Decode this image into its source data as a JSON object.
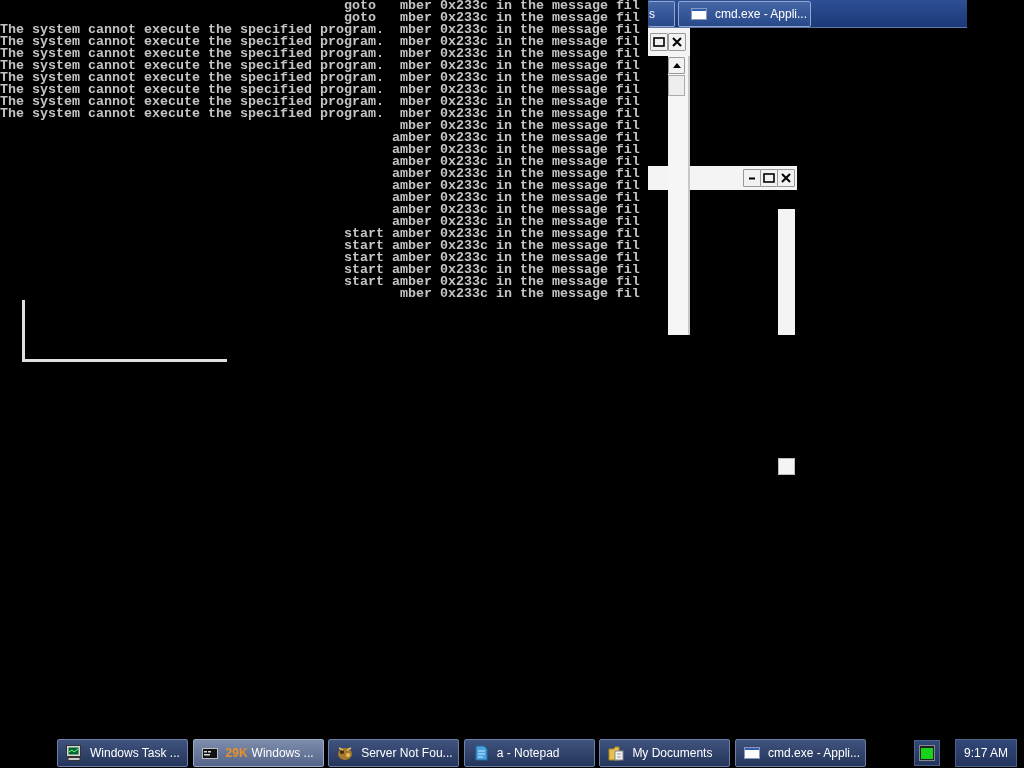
{
  "console": {
    "lines": [
      "                                           goto   mber 0x233c in the message fil",
      "                                           goto   mber 0x233c in the message fil",
      "The system cannot execute the specified program.  mber 0x233c in the message fil",
      "The system cannot execute the specified program.  mber 0x233c in the message fil",
      "The system cannot execute the specified program.  mber 0x233c in the message fil",
      "The system cannot execute the specified program.  mber 0x233c in the message fil",
      "The system cannot execute the specified program.  mber 0x233c in the message fil",
      "The system cannot execute the specified program.  mber 0x233c in the message fil",
      "The system cannot execute the specified program.  mber 0x233c in the message fil",
      "The system cannot execute the specified program.  mber 0x233c in the message fil",
      "                                                  mber 0x233c in the message fil",
      "                                                 amber 0x233c in the message fil",
      "                                                 amber 0x233c in the message fil",
      "                                                 amber 0x233c in the message fil",
      "                                                 amber 0x233c in the message fil",
      "                                                 amber 0x233c in the message fil",
      "                                                 amber 0x233c in the message fil",
      "                                                 amber 0x233c in the message fil",
      "                                                 amber 0x233c in the message fil",
      "                                           start amber 0x233c in the message fil",
      "                                           start amber 0x233c in the message fil",
      "                                           start amber 0x233c in the message fil",
      "                                           start amber 0x233c in the message fil",
      "                                           start amber 0x233c in the message fil",
      "                                                  mber 0x233c in the message fil"
    ]
  },
  "top_taskbar_fragment": {
    "buttons": [
      {
        "label": "s"
      },
      {
        "label": "cmd.exe - Appli..."
      }
    ]
  },
  "taskbar": {
    "buttons": [
      {
        "label": "Windows Task ...",
        "grouped": false,
        "selected": false
      },
      {
        "count": "29K",
        "label": "Windows ...",
        "grouped": true,
        "selected": true
      },
      {
        "label": "Server Not Fou...",
        "grouped": false,
        "selected": false
      },
      {
        "label": "a - Notepad",
        "grouped": false,
        "selected": false
      },
      {
        "label": "My Documents",
        "grouped": false,
        "selected": false
      },
      {
        "label": "cmd.exe - Appli...",
        "grouped": false,
        "selected": false
      }
    ],
    "tray": {
      "clock": "9:17 AM"
    }
  }
}
